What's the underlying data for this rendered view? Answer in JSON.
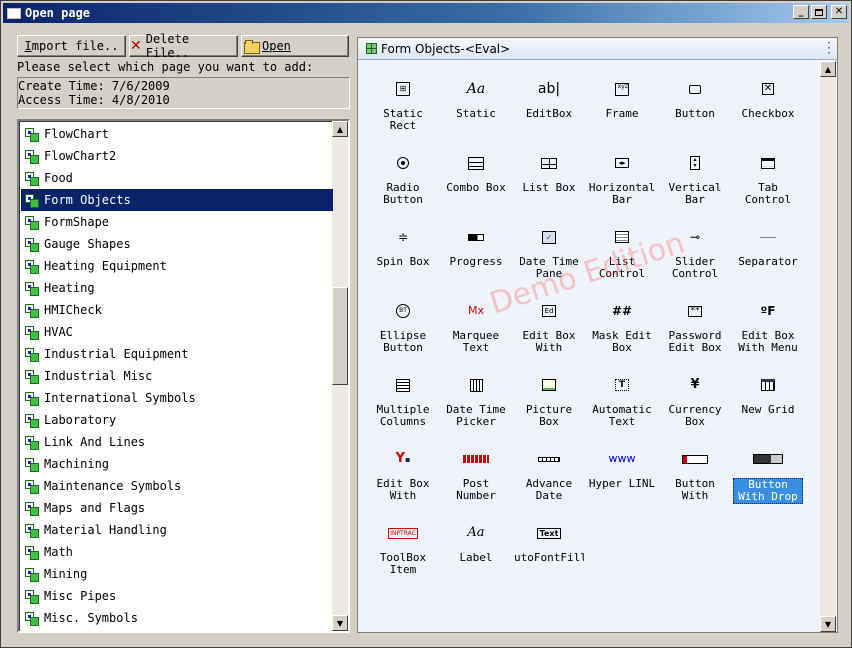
{
  "window": {
    "title": "Open page"
  },
  "toolbar": {
    "import_label_pre": "I",
    "import_label_post": "mport file..",
    "delete_label": "Delete File..",
    "open_label": "Open"
  },
  "prompt": "Please select which page you want to add:",
  "info": {
    "create": "Create Time: 7/6/2009",
    "access": "Access Time: 4/8/2010"
  },
  "pages": [
    "FlowChart",
    "FlowChart2",
    "Food",
    "Form Objects",
    "FormShape",
    "Gauge Shapes",
    "Heating Equipment",
    "Heating",
    "HMICheck",
    "HVAC",
    "Industrial Equipment",
    "Industrial Misc",
    "International Symbols",
    "Laboratory",
    "Link And Lines",
    "Machining",
    "Maintenance Symbols",
    "Maps and Flags",
    "Material Handling",
    "Math",
    "Mining",
    "Misc Pipes",
    "Misc. Symbols"
  ],
  "selected_page": "Form Objects",
  "panel": {
    "title": "Form Objects-<Eval>"
  },
  "watermark": "Demo Edition",
  "objects": [
    {
      "label": "Static\nRect",
      "icon": "static-rect-icon"
    },
    {
      "label": "Static",
      "icon": "static-text-icon"
    },
    {
      "label": "EditBox",
      "icon": "editbox-icon"
    },
    {
      "label": "Frame",
      "icon": "frame-icon"
    },
    {
      "label": "Button",
      "icon": "button-icon"
    },
    {
      "label": "Checkbox",
      "icon": "checkbox-icon"
    },
    {
      "label": "Radio\nButton",
      "icon": "radio-icon"
    },
    {
      "label": "Combo Box",
      "icon": "combo-box-icon"
    },
    {
      "label": "List Box",
      "icon": "list-box-icon"
    },
    {
      "label": "Horizontal\nBar",
      "icon": "horizontal-bar-icon"
    },
    {
      "label": "Vertical\nBar",
      "icon": "vertical-bar-icon"
    },
    {
      "label": "Tab\nControl",
      "icon": "tab-control-icon"
    },
    {
      "label": "Spin Box",
      "icon": "spin-box-icon"
    },
    {
      "label": "Progress",
      "icon": "progress-icon"
    },
    {
      "label": "Date Time\nPane",
      "icon": "date-time-pane-icon"
    },
    {
      "label": "List\nControl",
      "icon": "list-control-icon"
    },
    {
      "label": "Slider\nControl",
      "icon": "slider-icon"
    },
    {
      "label": "Separator",
      "icon": "separator-icon"
    },
    {
      "label": "Ellipse\nButton",
      "icon": "ellipse-button-icon"
    },
    {
      "label": "Marquee\nText",
      "icon": "marquee-icon"
    },
    {
      "label": "Edit Box\nWith",
      "icon": "edit-box-with-icon"
    },
    {
      "label": "Mask Edit\nBox",
      "icon": "mask-edit-icon"
    },
    {
      "label": "Password\nEdit Box",
      "icon": "password-icon"
    },
    {
      "label": "Edit Box\nWith Menu",
      "icon": "edit-menu-icon"
    },
    {
      "label": "Multiple\nColumns",
      "icon": "multi-columns-icon"
    },
    {
      "label": "Date Time\nPicker",
      "icon": "date-picker-icon"
    },
    {
      "label": "Picture\nBox",
      "icon": "picture-box-icon"
    },
    {
      "label": "Automatic\nText",
      "icon": "automatic-text-icon"
    },
    {
      "label": "Currency\nBox",
      "icon": "currency-icon"
    },
    {
      "label": "New Grid",
      "icon": "grid-icon"
    },
    {
      "label": "Edit Box\nWith",
      "icon": "edit-box-with2-icon"
    },
    {
      "label": "Post\nNumber",
      "icon": "post-number-icon"
    },
    {
      "label": "Advance\nDate",
      "icon": "advance-date-icon"
    },
    {
      "label": "Hyper LINL",
      "icon": "hyperlink-icon"
    },
    {
      "label": "Button\nWith",
      "icon": "button-with-icon"
    },
    {
      "label": "Button\nWith Drop",
      "icon": "button-drop-icon"
    },
    {
      "label": "ToolBox\nItem",
      "icon": "toolbox-icon"
    },
    {
      "label": "Label",
      "icon": "label-icon"
    },
    {
      "label": "utoFontFillS",
      "icon": "autofont-icon"
    }
  ],
  "selected_object": "Button\nWith Drop"
}
